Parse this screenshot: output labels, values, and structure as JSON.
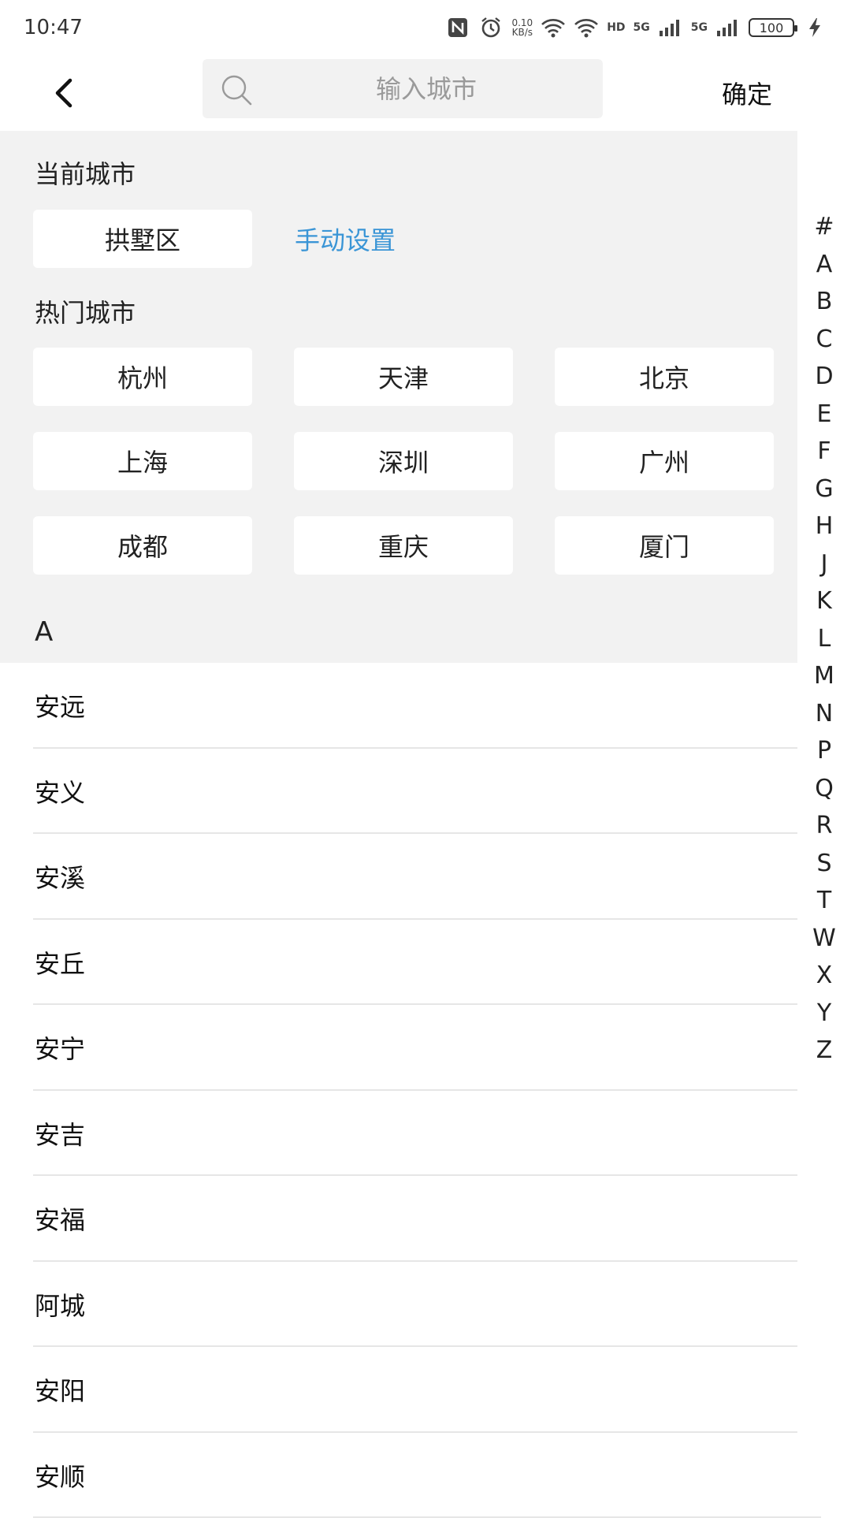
{
  "status_bar": {
    "time": "10:47",
    "speed_value": "0.10",
    "speed_unit": "KB/s",
    "hd_label": "HD",
    "network_1": "5G",
    "network_2": "5G",
    "battery": "100"
  },
  "header": {
    "search_placeholder": "输入城市",
    "confirm_label": "确定"
  },
  "current_city": {
    "title": "当前城市",
    "city": "拱墅区",
    "manual_label": "手动设置"
  },
  "hot_cities": {
    "title": "热门城市",
    "items": [
      "杭州",
      "天津",
      "北京",
      "上海",
      "深圳",
      "广州",
      "成都",
      "重庆",
      "厦门"
    ]
  },
  "list": {
    "letter": "A",
    "items": [
      "安远",
      "安义",
      "安溪",
      "安丘",
      "安宁",
      "安吉",
      "安福",
      "阿城",
      "安阳",
      "安顺"
    ]
  },
  "index": [
    "#",
    "A",
    "B",
    "C",
    "D",
    "E",
    "F",
    "G",
    "H",
    "J",
    "K",
    "L",
    "M",
    "N",
    "P",
    "Q",
    "R",
    "S",
    "T",
    "W",
    "X",
    "Y",
    "Z"
  ],
  "colors": {
    "accent": "#3a95d6",
    "section_bg": "#f2f2f2"
  }
}
